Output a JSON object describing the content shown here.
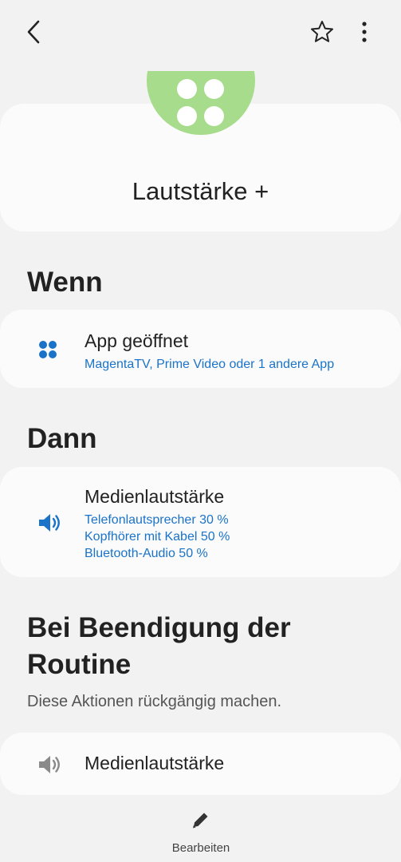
{
  "topbar": {
    "back_icon": "chevron-left-icon",
    "favorite_icon": "star-outline-icon",
    "more_icon": "more-vertical-icon"
  },
  "header": {
    "title": "Lautstärke +",
    "icon": "four-dots-icon",
    "icon_color": "#a6dc8b"
  },
  "if_section": {
    "heading": "Wenn",
    "item": {
      "icon": "apps-icon",
      "title": "App geöffnet",
      "detail": "MagentaTV, Prime Video oder 1 andere App"
    }
  },
  "then_section": {
    "heading": "Dann",
    "item": {
      "icon": "volume-icon",
      "title": "Medienlautstärke",
      "details": [
        "Telefonlautsprecher 30 %",
        "Kopfhörer mit Kabel 50 %",
        "Bluetooth-Audio 50 %"
      ]
    }
  },
  "end_section": {
    "heading_line1": "Bei Beendigung der",
    "heading_line2": "Routine",
    "subtitle": "Diese Aktionen rückgängig machen.",
    "item": {
      "icon": "volume-icon",
      "title": "Medienlautstärke"
    }
  },
  "bottom_bar": {
    "edit_label": "Bearbeiten",
    "edit_icon": "pencil-icon"
  },
  "colors": {
    "accent": "#1a73c8",
    "background": "#f2f2f2",
    "card": "#fbfbfb"
  }
}
